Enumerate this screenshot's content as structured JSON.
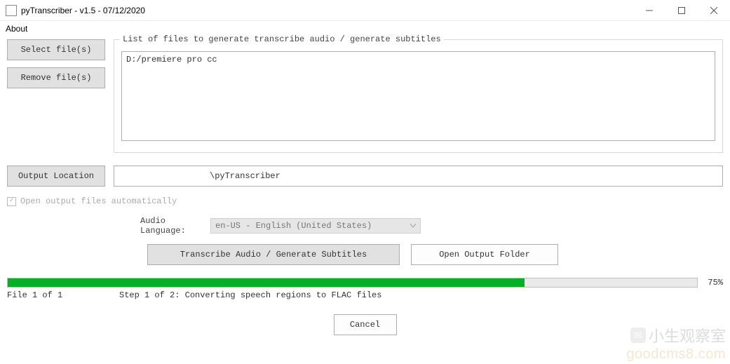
{
  "window": {
    "title": "pyTranscriber - v1.5 - 07/12/2020"
  },
  "menu": {
    "about": "About"
  },
  "sidebar": {
    "select_files": "Select file(s)",
    "remove_files": "Remove file(s)"
  },
  "files_group": {
    "label": "List of files to generate transcribe audio / generate subtitles",
    "items": [
      "D:/premiere pro cc"
    ]
  },
  "output": {
    "button": "Output Location",
    "path_suffix": "\\pyTranscriber"
  },
  "open_auto": {
    "label": "Open output files automatically",
    "checked": true
  },
  "language": {
    "label": "Audio Language:",
    "selected": "en-US - English (United States)"
  },
  "actions": {
    "transcribe": "Transcribe Audio / Generate Subtitles",
    "open_output": "Open Output Folder",
    "cancel": "Cancel"
  },
  "progress": {
    "percent": 75,
    "percent_label": "75%",
    "file_label": "File 1 of 1",
    "step_label": "Step 1 of 2: Converting speech regions to FLAC files"
  },
  "watermark": {
    "cn": "小生观察室",
    "en": "goodcms8.com"
  }
}
